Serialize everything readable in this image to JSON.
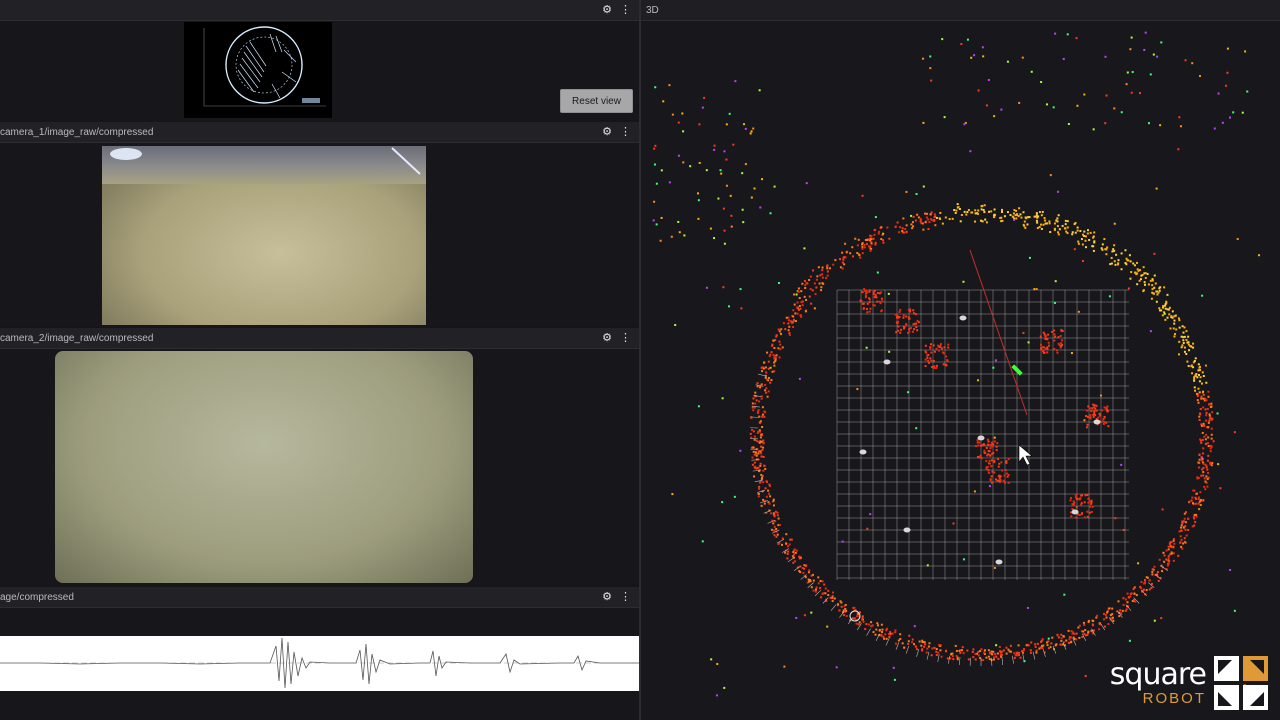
{
  "panels": {
    "top_left": {
      "title": ""
    },
    "camera1": {
      "title": "camera_1/image_raw/compressed"
    },
    "camera2": {
      "title": "camera_2/image_raw/compressed"
    },
    "sonar": {
      "title": "age/compressed"
    },
    "three_d": {
      "title": "3D"
    }
  },
  "icons": {
    "settings": "⚙",
    "more": "⋮"
  },
  "reset_view_label": "Reset view",
  "logo": {
    "main": "square",
    "sub": "ROBOT"
  },
  "colors": {
    "background": "#16161a",
    "header": "#222226",
    "accent_orange": "#e09a35",
    "point_hot": "#ff3a1a",
    "point_warm": "#ffb000",
    "grid": "#d8d8d8"
  }
}
